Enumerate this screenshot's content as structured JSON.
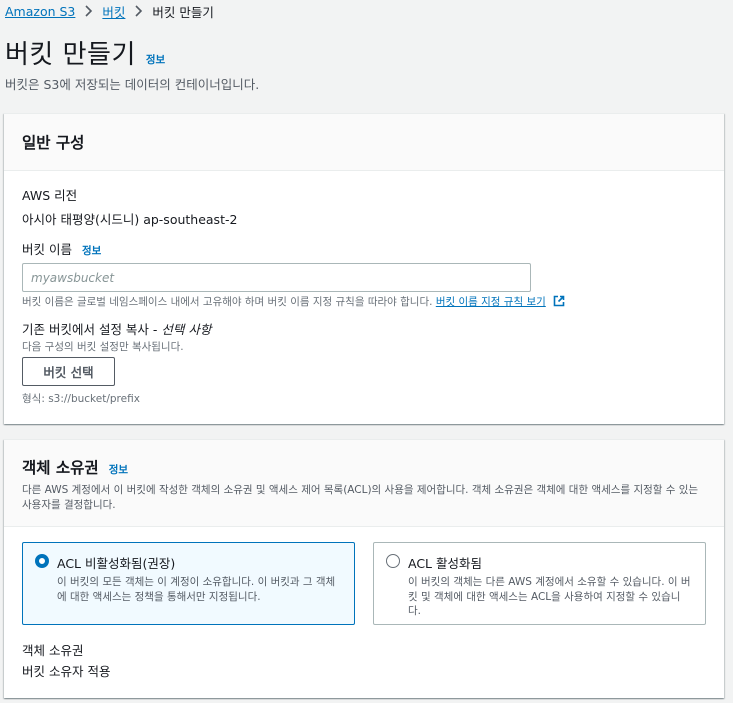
{
  "breadcrumb": {
    "items": [
      "Amazon S3",
      "버킷",
      "버킷 만들기"
    ]
  },
  "page": {
    "title": "버킷 만들기",
    "info": "정보",
    "description": "버킷은 S3에 저장되는 데이터의 컨테이너입니다."
  },
  "general": {
    "heading": "일반 구성",
    "region_label": "AWS 리전",
    "region_value": "아시아 태평양(시드니) ap-southeast-2",
    "bucket_name_label": "버킷 이름",
    "bucket_name_info": "정보",
    "bucket_name_placeholder": "myawsbucket",
    "bucket_name_value": "",
    "bucket_name_help": "버킷 이름은 글로벌 네임스페이스 내에서 고유해야 하며 버킷 이름 지정 규칙을 따라야 합니다.",
    "naming_rules_link": "버킷 이름 지정 규칙 보기",
    "copy_label_main": "기존 버킷에서 설정 복사 -",
    "copy_label_optional": "선택 사항",
    "copy_desc": "다음 구성의 버킷 설정만 복사됩니다.",
    "choose_bucket_button": "버킷 선택",
    "format_hint": "형식: s3://bucket/prefix"
  },
  "ownership": {
    "heading": "객체 소유권",
    "info": "정보",
    "description": "다른 AWS 계정에서 이 버킷에 작성한 객체의 소유권 및 액세스 제어 목록(ACL)의 사용을 제어합니다. 객체 소유권은 객체에 대한 액세스를 지정할 수 있는 사용자를 결정합니다.",
    "options": [
      {
        "title": "ACL 비활성화됨(권장)",
        "desc": "이 버킷의 모든 객체는 이 계정이 소유합니다. 이 버킷과 그 객체에 대한 액세스는 정책을 통해서만 지정됩니다.",
        "selected": true
      },
      {
        "title": "ACL 활성화됨",
        "desc": "이 버킷의 객체는 다른 AWS 계정에서 소유할 수 있습니다. 이 버킷 및 객체에 대한 액세스는 ACL을 사용하여 지정할 수 있습니다.",
        "selected": false
      }
    ],
    "owner_label": "객체 소유권",
    "owner_value": "버킷 소유자 적용"
  },
  "colors": {
    "link": "#0073bb",
    "background": "#f2f3f3",
    "selected_tile": "#f1faff"
  }
}
